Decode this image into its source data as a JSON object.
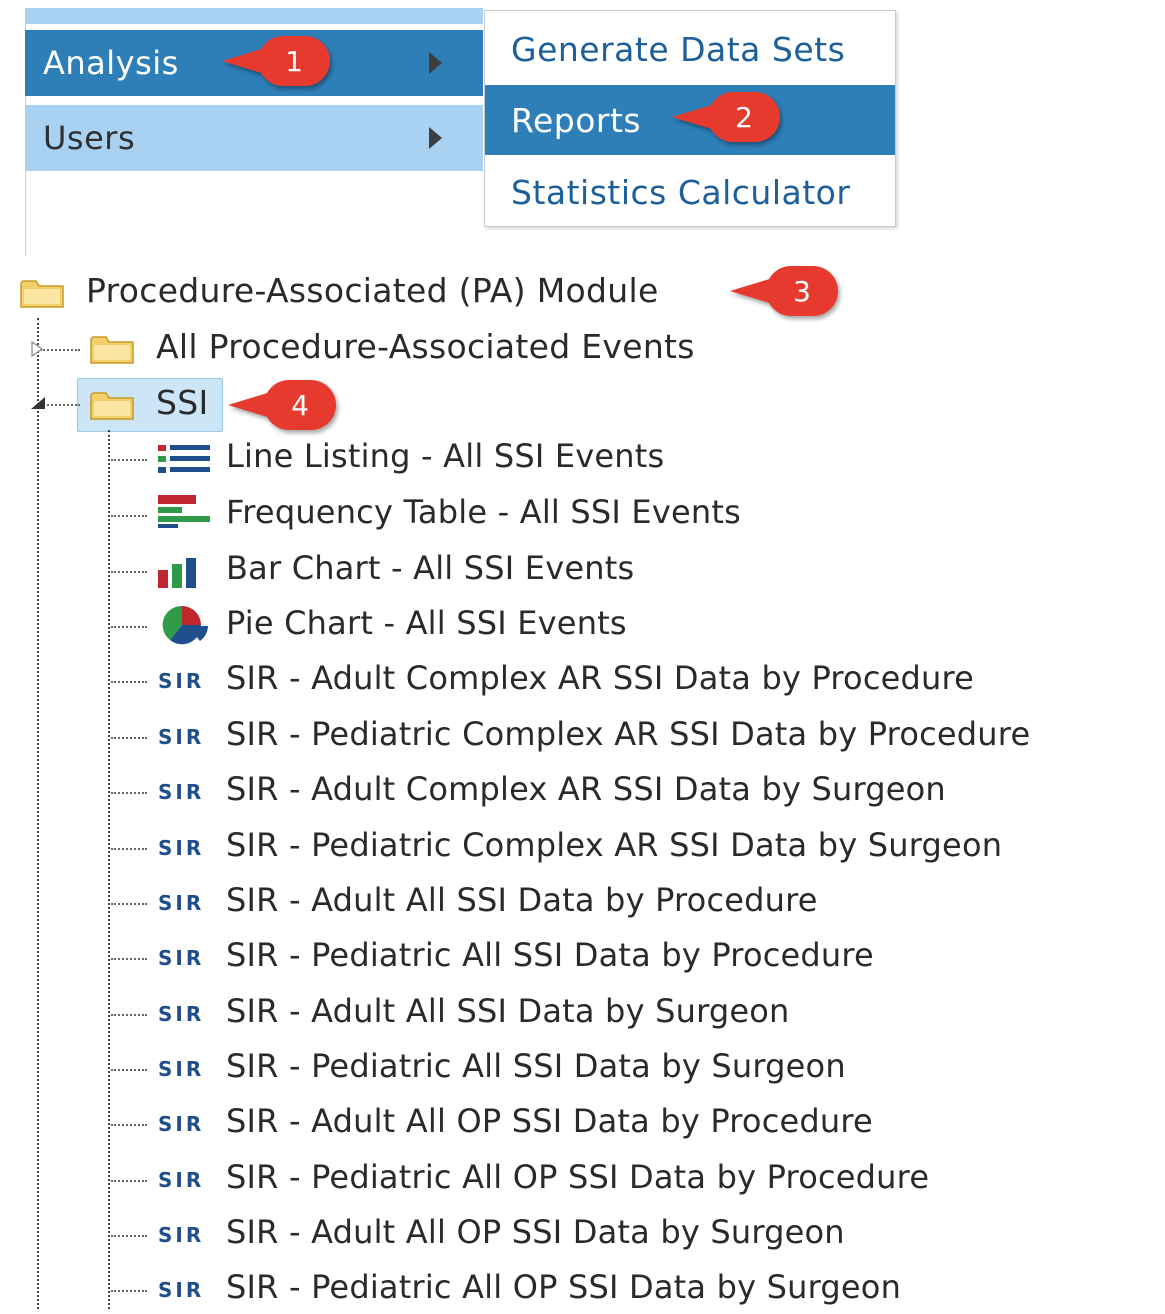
{
  "menu": {
    "items": [
      {
        "label": "Analysis",
        "active": true
      },
      {
        "label": "Users",
        "active": false
      }
    ],
    "submenu": [
      {
        "label": "Generate Data Sets"
      },
      {
        "label": "Reports",
        "active": true
      },
      {
        "label": "Statistics Calculator"
      }
    ]
  },
  "callouts": [
    "1",
    "2",
    "3",
    "4"
  ],
  "tree": {
    "root": "Procedure-Associated (PA) Module",
    "folders": [
      {
        "label": "All Procedure-Associated Events",
        "expanded": false
      },
      {
        "label": "SSI",
        "expanded": true,
        "selected": true
      }
    ],
    "reports": [
      {
        "icon": "line-listing-icon",
        "label": "Line Listing - All SSI Events"
      },
      {
        "icon": "frequency-table-icon",
        "label": "Frequency Table - All SSI Events"
      },
      {
        "icon": "bar-chart-icon",
        "label": "Bar Chart - All SSI Events"
      },
      {
        "icon": "pie-chart-icon",
        "label": "Pie Chart - All SSI Events"
      },
      {
        "icon": "sir-icon",
        "icon_text": "SIR",
        "label": "SIR - Adult Complex AR SSI Data by Procedure"
      },
      {
        "icon": "sir-icon",
        "icon_text": "SIR",
        "label": "SIR - Pediatric Complex AR SSI Data by Procedure"
      },
      {
        "icon": "sir-icon",
        "icon_text": "SIR",
        "label": "SIR - Adult Complex AR SSI Data by Surgeon"
      },
      {
        "icon": "sir-icon",
        "icon_text": "SIR",
        "label": "SIR - Pediatric Complex AR SSI Data by Surgeon"
      },
      {
        "icon": "sir-icon",
        "icon_text": "SIR",
        "label": "SIR - Adult All SSI Data by Procedure"
      },
      {
        "icon": "sir-icon",
        "icon_text": "SIR",
        "label": "SIR - Pediatric All SSI Data by Procedure"
      },
      {
        "icon": "sir-icon",
        "icon_text": "SIR",
        "label": "SIR - Adult All SSI Data by Surgeon"
      },
      {
        "icon": "sir-icon",
        "icon_text": "SIR",
        "label": "SIR - Pediatric All SSI Data by Surgeon"
      },
      {
        "icon": "sir-icon",
        "icon_text": "SIR",
        "label": "SIR - Adult All OP SSI Data by Procedure"
      },
      {
        "icon": "sir-icon",
        "icon_text": "SIR",
        "label": "SIR - Pediatric All OP SSI Data by Procedure"
      },
      {
        "icon": "sir-icon",
        "icon_text": "SIR",
        "label": "SIR - Adult All OP SSI Data by Surgeon"
      },
      {
        "icon": "sir-icon",
        "icon_text": "SIR",
        "label": "SIR - Pediatric All OP SSI Data by Surgeon"
      }
    ]
  },
  "colors": {
    "menu_active": "#2e7fb8",
    "menu_inactive": "#a9d2f2",
    "submenu_text": "#1d5f99",
    "callout": "#e63a2e",
    "selected_bg": "#cde6f7"
  }
}
